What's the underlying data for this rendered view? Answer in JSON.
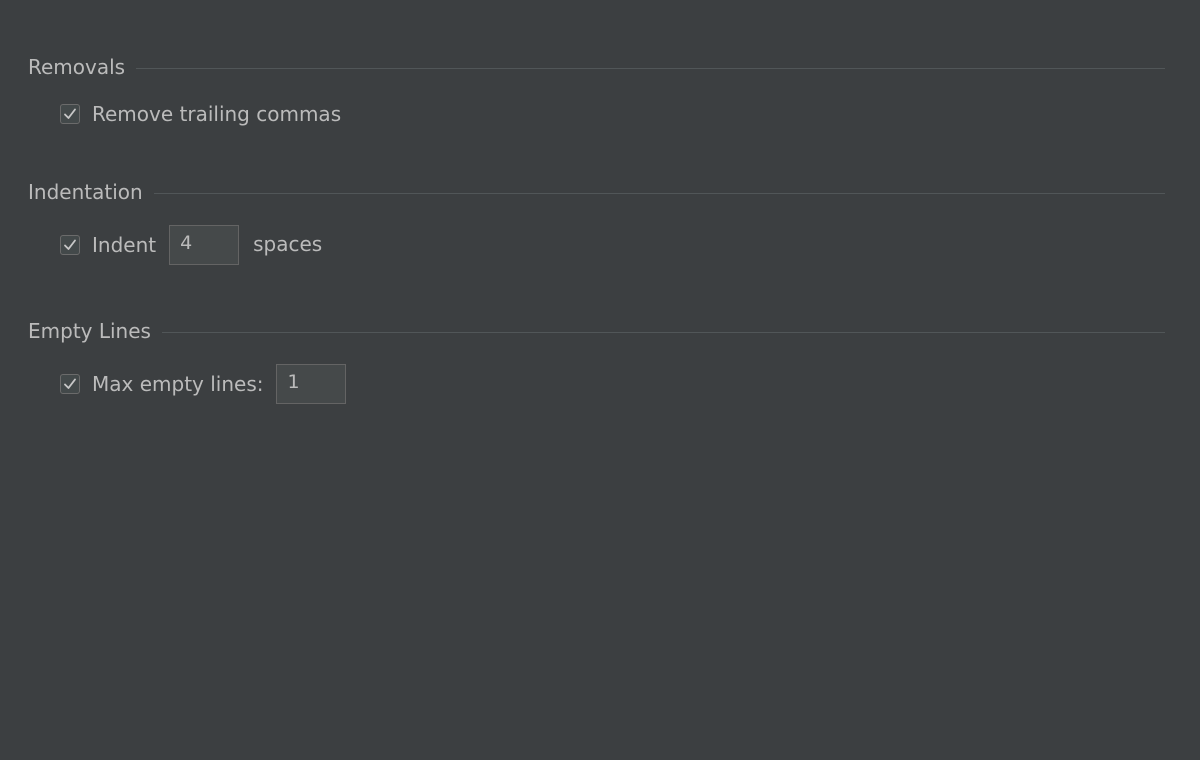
{
  "sections": {
    "removals": {
      "title": "Removals",
      "remove_trailing_commas": {
        "checked": true,
        "label": "Remove trailing commas"
      }
    },
    "indentation": {
      "title": "Indentation",
      "indent": {
        "checked": true,
        "label": "Indent",
        "value": "4",
        "suffix": "spaces"
      }
    },
    "empty_lines": {
      "title": "Empty Lines",
      "max_empty_lines": {
        "checked": true,
        "label": "Max empty lines:",
        "value": "1"
      }
    }
  },
  "colors": {
    "background": "#3c3f41",
    "text": "#bbbbbb",
    "separator": "#515658",
    "checkbox_border": "#6b6b6b",
    "input_background": "#45494a",
    "input_border": "#646464"
  },
  "icons": {
    "checkmark": "check-icon"
  }
}
